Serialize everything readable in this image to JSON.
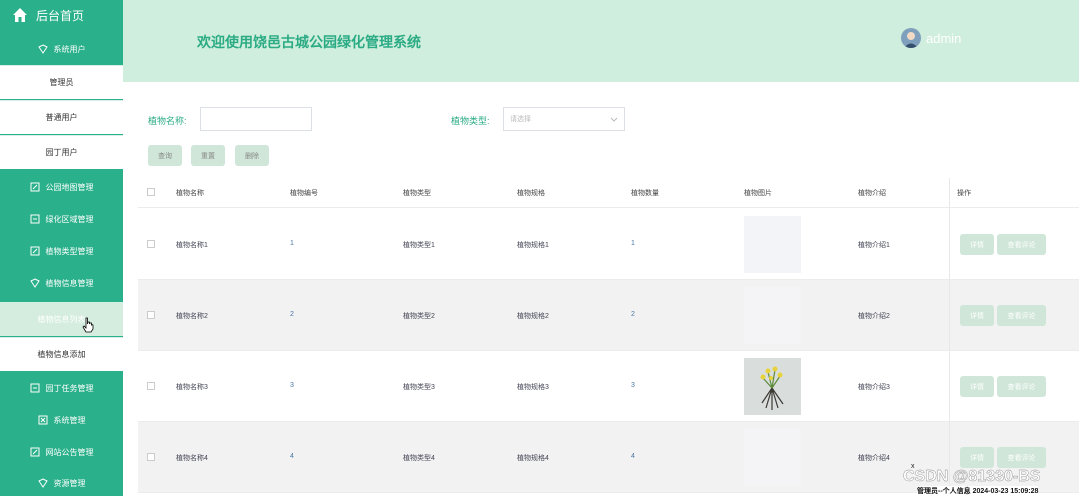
{
  "sidebar": {
    "home_label": "后台首页",
    "groups": [
      {
        "label": "系统用户",
        "icon": "shield-icon"
      },
      {
        "label": "公园地图管理",
        "icon": "edit-icon"
      },
      {
        "label": "绿化区域管理",
        "icon": "grid-icon"
      },
      {
        "label": "植物类型管理",
        "icon": "edit-icon"
      },
      {
        "label": "植物信息管理",
        "icon": "shield-icon"
      },
      {
        "label": "园丁任务管理",
        "icon": "grid-icon"
      },
      {
        "label": "系统管理",
        "icon": "grid-icon"
      },
      {
        "label": "网站公告管理",
        "icon": "edit-icon"
      },
      {
        "label": "资源管理",
        "icon": "shield-icon"
      }
    ],
    "sub_users": [
      "管理员",
      "普通用户",
      "园丁用户"
    ],
    "sub_plant": [
      "植物信息列表",
      "植物信息添加"
    ]
  },
  "header": {
    "title": "欢迎使用饶邑古城公园绿化管理系统",
    "username": "admin"
  },
  "search": {
    "name_label": "植物名称:",
    "type_label": "植物类型:",
    "type_placeholder": "请选择",
    "query": "查询",
    "reset": "重置",
    "delete": "删除"
  },
  "table": {
    "headers": [
      "植物名称",
      "植物编号",
      "植物类型",
      "植物规格",
      "植物数量",
      "植物图片",
      "植物介绍",
      "操作"
    ],
    "rows": [
      {
        "name": "植物名称1",
        "code": "1",
        "type": "植物类型1",
        "spec": "植物规格1",
        "qty": "1",
        "intro": "植物介绍1"
      },
      {
        "name": "植物名称2",
        "code": "2",
        "type": "植物类型2",
        "spec": "植物规格2",
        "qty": "2",
        "intro": "植物介绍2"
      },
      {
        "name": "植物名称3",
        "code": "3",
        "type": "植物类型3",
        "spec": "植物规格3",
        "qty": "3",
        "intro": "植物介绍3"
      },
      {
        "name": "植物名称4",
        "code": "4",
        "type": "植物类型4",
        "spec": "植物规格4",
        "qty": "4",
        "intro": "植物介绍4"
      }
    ],
    "detail": "详情",
    "review": "查看评论"
  },
  "watermark": "CSDN @81330-BS",
  "status_bar": "管理员--个人信息 2024-03-23 15:09:28",
  "colors": {
    "primary": "#2ab08a",
    "header_bg": "#cfeedd",
    "button_bg": "#cfe6d8"
  }
}
